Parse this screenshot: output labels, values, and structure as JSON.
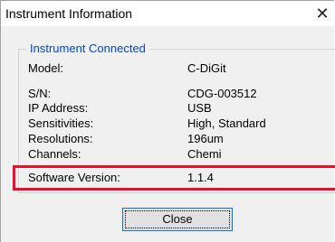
{
  "window": {
    "title": "Instrument Information",
    "close_glyph": "✕"
  },
  "group": {
    "title": "Instrument Connected"
  },
  "rows": [
    {
      "label": "Model:",
      "value": "C-DiGit"
    },
    {
      "label": "S/N:",
      "value": "CDG-003512"
    },
    {
      "label": "IP Address:",
      "value": "USB"
    },
    {
      "label": "Sensitivities:",
      "value": "High, Standard"
    },
    {
      "label": "Resolutions:",
      "value": "196um"
    },
    {
      "label": "Channels:",
      "value": "Chemi"
    },
    {
      "label": "Software Version:",
      "value": "1.1.4"
    }
  ],
  "highlight": {
    "color": "#e8112d",
    "target": "Software Version"
  },
  "footer": {
    "close_label": "Close"
  },
  "colors": {
    "group_title": "#0046d5",
    "button_border": "#0078d7"
  }
}
